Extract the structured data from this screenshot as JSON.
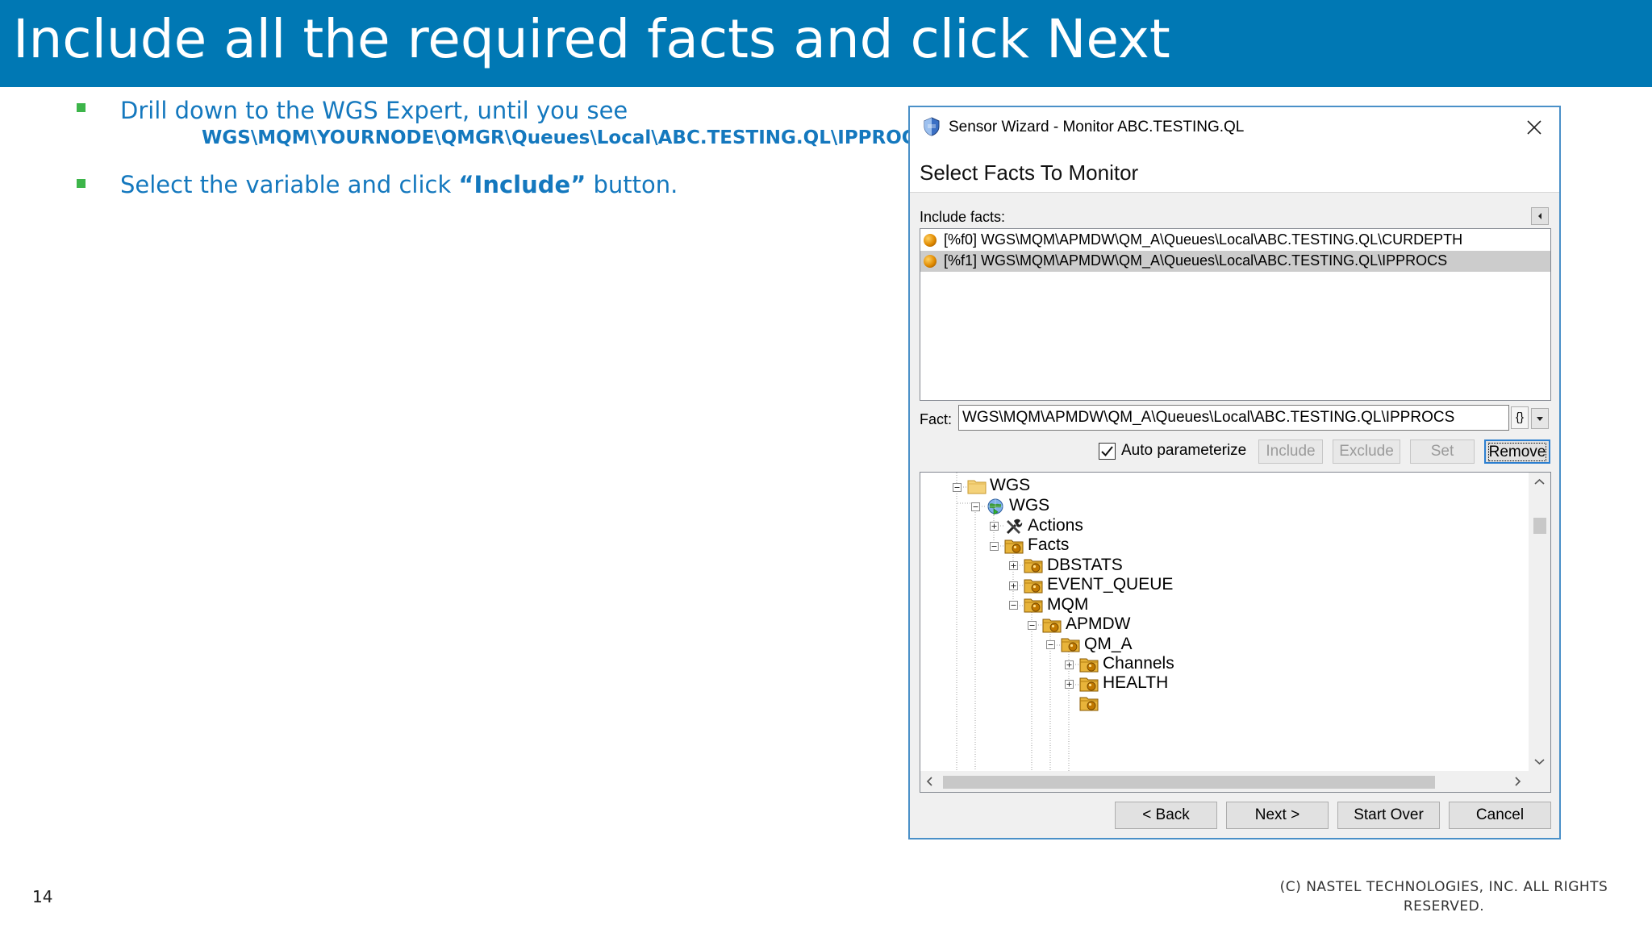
{
  "slide": {
    "title": "Include all the required facts and click Next",
    "bullet1": "Drill down to the WGS Expert, until you see",
    "bullet1_path": "WGS\\MQM\\YOURNODE\\QMGR\\Queues\\Local\\ABC.TESTING.QL\\IPPROCS",
    "bullet2_pre": "Select the variable and click ",
    "bullet2_bold": "“Include”",
    "bullet2_post": " button.",
    "page_number": "14",
    "copyright": "(C) NASTEL TECHNOLOGIES, INC. ALL RIGHTS RESERVED.",
    "colors": {
      "title_bar": "#0078B4",
      "text": "#1478BE",
      "bullet": "#3DB54A"
    }
  },
  "dialog": {
    "title": "Sensor Wizard - Monitor ABC.TESTING.QL",
    "heading": "Select Facts To Monitor",
    "include_label": "Include facts:",
    "facts": [
      "[%f0] WGS\\MQM\\APMDW\\QM_A\\Queues\\Local\\ABC.TESTING.QL\\CURDEPTH",
      "[%f1] WGS\\MQM\\APMDW\\QM_A\\Queues\\Local\\ABC.TESTING.QL\\IPPROCS"
    ],
    "selected_fact_index": 1,
    "fact_label": "Fact:",
    "fact_value": "WGS\\MQM\\APMDW\\QM_A\\Queues\\Local\\ABC.TESTING.QL\\IPPROCS",
    "brace_button": "{}",
    "auto_param_label": "Auto parameterize",
    "auto_param_checked": true,
    "buttons": {
      "include": "Include",
      "exclude": "Exclude",
      "set": "Set",
      "remove": "Remove",
      "back": "< Back",
      "next": "Next >",
      "start_over": "Start Over",
      "cancel": "Cancel"
    },
    "tree": [
      {
        "label": "WGS",
        "icon": "folder-icon"
      },
      {
        "label": "WGS",
        "icon": "globe-icon"
      },
      {
        "label": "Actions",
        "icon": "tools-icon"
      },
      {
        "label": "Facts",
        "icon": "facts-folder-icon"
      },
      {
        "label": "DBSTATS",
        "icon": "facts-folder-icon"
      },
      {
        "label": "EVENT_QUEUE",
        "icon": "facts-folder-icon"
      },
      {
        "label": "MQM",
        "icon": "facts-folder-icon"
      },
      {
        "label": "APMDW",
        "icon": "facts-folder-icon"
      },
      {
        "label": "QM_A",
        "icon": "facts-folder-icon"
      },
      {
        "label": "Channels",
        "icon": "facts-folder-icon"
      },
      {
        "label": "HEALTH",
        "icon": "facts-folder-icon"
      }
    ]
  }
}
